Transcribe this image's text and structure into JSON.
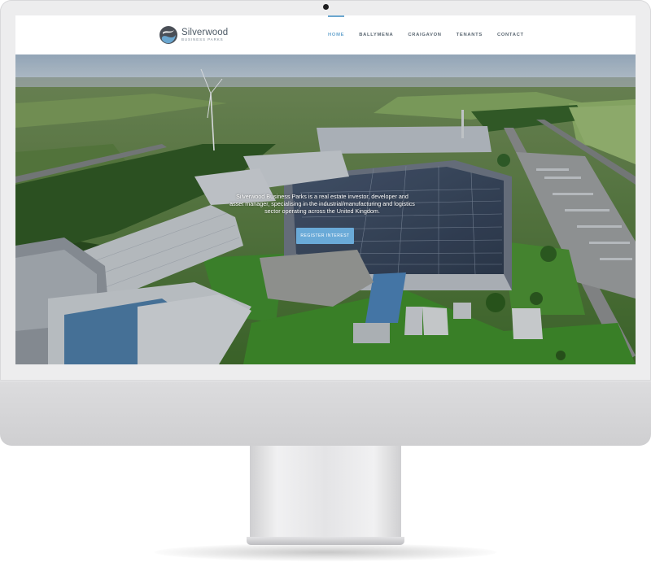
{
  "site": {
    "logo": {
      "name": "Silverwood",
      "subtitle": "BUSINESS PARKS",
      "icon": "silverwood-swirl-icon"
    },
    "nav": {
      "items": [
        {
          "label": "HOME",
          "active": true
        },
        {
          "label": "BALLYMENA",
          "active": false
        },
        {
          "label": "CRAIGAVON",
          "active": false
        },
        {
          "label": "TENANTS",
          "active": false
        },
        {
          "label": "CONTACT",
          "active": false
        }
      ]
    },
    "hero": {
      "text": "Silverwood Business Parks is a real estate investor, developer and asset manager, specialising in the industrial/manufacturing and logistics sector operating across the United Kingdom.",
      "cta_label": "REGISTER INTEREST",
      "image": "aerial-business-park-photo"
    }
  },
  "colors": {
    "accent": "#6aa6cf",
    "button": "#6aaad8",
    "nav_text": "#5c6873",
    "bezel": "#ededee"
  }
}
